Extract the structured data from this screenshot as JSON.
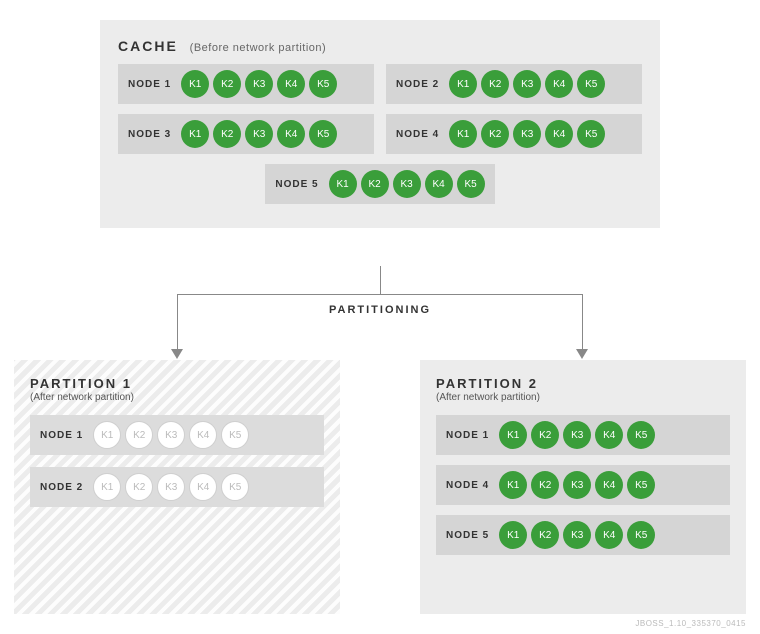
{
  "cache": {
    "title": "CACHE",
    "subtitle": "(Before network partition)",
    "nodes": [
      {
        "label": "NODE 1",
        "keys": [
          "K1",
          "K2",
          "K3",
          "K4",
          "K5"
        ]
      },
      {
        "label": "NODE 2",
        "keys": [
          "K1",
          "K2",
          "K3",
          "K4",
          "K5"
        ]
      },
      {
        "label": "NODE 3",
        "keys": [
          "K1",
          "K2",
          "K3",
          "K4",
          "K5"
        ]
      },
      {
        "label": "NODE 4",
        "keys": [
          "K1",
          "K2",
          "K3",
          "K4",
          "K5"
        ]
      },
      {
        "label": "NODE 5",
        "keys": [
          "K1",
          "K2",
          "K3",
          "K4",
          "K5"
        ]
      }
    ]
  },
  "splitLabel": "PARTITIONING",
  "partition1": {
    "title": "PARTITION 1",
    "subtitle": "(After network partition)",
    "nodes": [
      {
        "label": "NODE 1",
        "keys": [
          "K1",
          "K2",
          "K3",
          "K4",
          "K5"
        ]
      },
      {
        "label": "NODE 2",
        "keys": [
          "K1",
          "K2",
          "K3",
          "K4",
          "K5"
        ]
      }
    ]
  },
  "partition2": {
    "title": "PARTITION 2",
    "subtitle": "(After network partition)",
    "nodes": [
      {
        "label": "NODE 1",
        "keys": [
          "K1",
          "K2",
          "K3",
          "K4",
          "K5"
        ]
      },
      {
        "label": "NODE 4",
        "keys": [
          "K1",
          "K2",
          "K3",
          "K4",
          "K5"
        ]
      },
      {
        "label": "NODE 5",
        "keys": [
          "K1",
          "K2",
          "K3",
          "K4",
          "K5"
        ]
      }
    ]
  },
  "footerId": "JBOSS_1.10_335370_0415"
}
